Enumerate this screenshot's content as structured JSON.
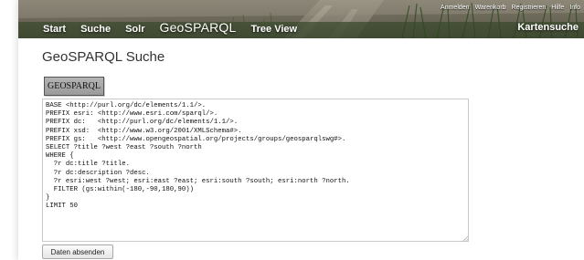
{
  "header": {
    "main_nav": [
      "Start",
      "Suche",
      "Solr",
      "GeoSPARQL",
      "Tree View"
    ],
    "utility_nav": [
      "Anmelden",
      "Warenkorb",
      "Registrieren",
      "Hilfe",
      "Info"
    ],
    "map_search_label": "Kartensuche"
  },
  "page": {
    "title": "GeoSPARQL Suche"
  },
  "query_panel": {
    "tab_button_label": "GEOSPARQL",
    "query_text": "BASE <http://purl.org/dc/elements/1.1/>.\nPREFIX esri: <http://www.esri.com/sparql/>.\nPREFIX dc:   <http://purl.org/dc/elements/1.1/>.\nPREFIX xsd:  <http://www.w3.org/2001/XMLSchema#>.\nPREFIX gs:   <http://www.opengeospatial.org/projects/groups/geosparqlswg#>.\nSELECT ?title ?west ?east ?south ?north\nWHERE {\n  ?r dc:title ?title.\n  ?r dc:description ?desc.\n  ?r esri:west ?west; esri:east ?east; esri:south ?south; esri:north ?north.\n  FILTER (gs:within(-180,-90,180,90))\n}\nLIMIT 50",
    "submit_label": "Daten absenden"
  },
  "colors": {
    "header_text": "#ffffff",
    "button_gray": "#a6a6a6",
    "title_text": "#333333"
  }
}
